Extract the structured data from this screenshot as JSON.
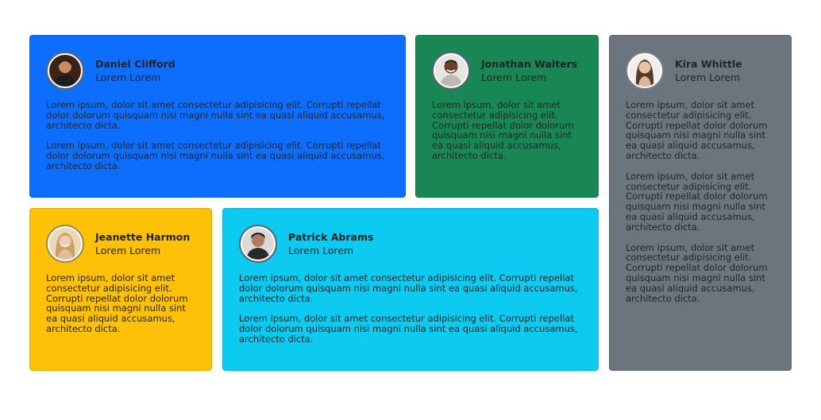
{
  "cards": [
    {
      "name": "Daniel Clifford",
      "role": "Lorem Lorem",
      "color": "#0d6efd",
      "avatar_icon": "person-portrait-icon",
      "paragraphs": [
        "Lorem ipsum, dolor sit amet consectetur adipisicing elit. Corrupti repellat dolor dolorum quisquam nisi magni nulla sint ea quasi aliquid accusamus, architecto dicta.",
        "Lorem ipsum, dolor sit amet consectetur adipisicing elit. Corrupti repellat dolor dolorum quisquam nisi magni nulla sint ea quasi aliquid accusamus, architecto dicta."
      ]
    },
    {
      "name": "Jonathan Walters",
      "role": "Lorem Lorem",
      "color": "#198754",
      "avatar_icon": "person-portrait-icon",
      "paragraphs": [
        "Lorem ipsum, dolor sit amet consectetur adipisicing elit. Corrupti repellat dolor dolorum quisquam nisi magni nulla sint ea quasi aliquid accusamus, architecto dicta."
      ]
    },
    {
      "name": "Kira Whittle",
      "role": "Lorem Lorem",
      "color": "#6c757d",
      "avatar_icon": "person-portrait-icon",
      "paragraphs": [
        "Lorem ipsum, dolor sit amet consectetur adipisicing elit. Corrupti repellat dolor dolorum quisquam nisi magni nulla sint ea quasi aliquid accusamus, architecto dicta.",
        "Lorem ipsum, dolor sit amet consectetur adipisicing elit. Corrupti repellat dolor dolorum quisquam nisi magni nulla sint ea quasi aliquid accusamus, architecto dicta.",
        "Lorem ipsum, dolor sit amet consectetur adipisicing elit. Corrupti repellat dolor dolorum quisquam nisi magni nulla sint ea quasi aliquid accusamus, architecto dicta."
      ]
    },
    {
      "name": "Jeanette Harmon",
      "role": "Lorem Lorem",
      "color": "#ffc107",
      "avatar_icon": "person-portrait-icon",
      "paragraphs": [
        "Lorem ipsum, dolor sit amet consectetur adipisicing elit. Corrupti repellat dolor dolorum quisquam nisi magni nulla sint ea quasi aliquid accusamus, architecto dicta."
      ]
    },
    {
      "name": "Patrick Abrams",
      "role": "Lorem Lorem",
      "color": "#0dcaf0",
      "avatar_icon": "person-portrait-icon",
      "paragraphs": [
        "Lorem ipsum, dolor sit amet consectetur adipisicing elit. Corrupti repellat dolor dolorum quisquam nisi magni nulla sint ea quasi aliquid accusamus, architecto dicta.",
        "Lorem ipsum, dolor sit amet consectetur adipisicing elit. Corrupti repellat dolor dolorum quisquam nisi magni nulla sint ea quasi aliquid accusamus, architecto dicta."
      ]
    }
  ]
}
